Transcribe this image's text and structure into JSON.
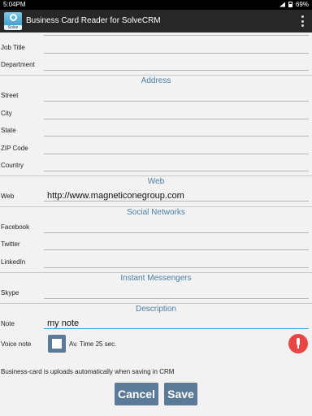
{
  "status_bar": {
    "time": "5:04PM",
    "battery": "69%"
  },
  "app": {
    "title": "Business Card Reader for SolveCRM",
    "icon_label": "Solve"
  },
  "fields": [
    {
      "label": "Job Title",
      "value": ""
    },
    {
      "label": "Department",
      "value": ""
    }
  ],
  "sections": {
    "address": "Address",
    "web": "Web",
    "social": "Social Networks",
    "im": "Instant Messengers",
    "description": "Description"
  },
  "address_fields": [
    {
      "label": "Street",
      "value": ""
    },
    {
      "label": "City",
      "value": ""
    },
    {
      "label": "State",
      "value": ""
    },
    {
      "label": "ZIP Code",
      "value": ""
    },
    {
      "label": "Country",
      "value": ""
    }
  ],
  "web_field": {
    "label": "Web",
    "value": "http://www.magneticonegroup.com"
  },
  "social_fields": [
    {
      "label": "Facebook",
      "value": ""
    },
    {
      "label": "Twitter",
      "value": ""
    },
    {
      "label": "LinkedIn",
      "value": ""
    }
  ],
  "im_field": {
    "label": "Skype",
    "value": ""
  },
  "note_field": {
    "label": "Note",
    "value": "my note"
  },
  "voice": {
    "label": "Voice note",
    "info": "Av. Time 25 sec."
  },
  "hint": "Business-card is uploads automatically when saving in CRM",
  "buttons": {
    "cancel": "Cancel",
    "save": "Save"
  }
}
